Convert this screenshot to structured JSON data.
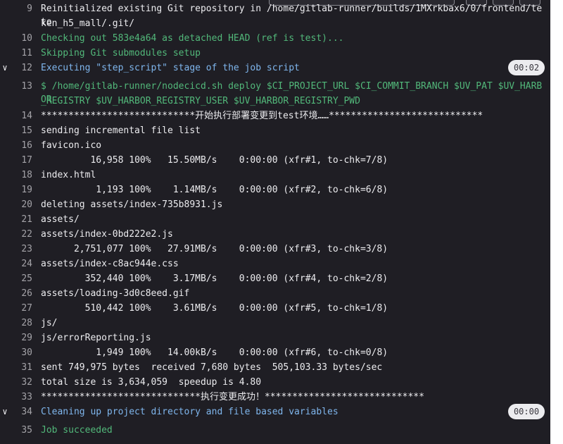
{
  "terminal": {
    "lines": [
      {
        "n": "9",
        "text": "Reinitialized existing Git repository in /home/gitlab-runner/builds/1MXrkbax6/0/frontend/teto",
        "color": "white"
      },
      {
        "n": "",
        "text": "ken_h5_mall/.git/",
        "color": "white"
      },
      {
        "n": "10",
        "text": "Checking out 583e4a64 as detached HEAD (ref is test)...",
        "color": "green"
      },
      {
        "n": "11",
        "text": "Skipping Git submodules setup",
        "color": "green"
      },
      {
        "n": "12",
        "text": "Executing \"step_script\" stage of the job script",
        "color": "blue",
        "collapsible": true,
        "duration": "00:02"
      },
      {
        "n": "13",
        "text": "$ /home/gitlab-runner/nodecicd.sh deploy $CI_PROJECT_URL $CI_COMMIT_BRANCH $UV_PAT $UV_HARBOR",
        "color": "green"
      },
      {
        "n": "",
        "text": "_REGISTRY $UV_HARBOR_REGISTRY_USER $UV_HARBOR_REGISTRY_PWD",
        "color": "green"
      },
      {
        "n": "14",
        "text": "****************************开始执行部署变更到test环境……****************************",
        "color": "white"
      },
      {
        "n": "15",
        "text": "sending incremental file list",
        "color": "white"
      },
      {
        "n": "16",
        "text": "favicon.ico",
        "color": "white"
      },
      {
        "n": "17",
        "text": "         16,958 100%   15.50MB/s    0:00:00 (xfr#1, to-chk=7/8)",
        "color": "white"
      },
      {
        "n": "18",
        "text": "index.html",
        "color": "white"
      },
      {
        "n": "19",
        "text": "          1,193 100%    1.14MB/s    0:00:00 (xfr#2, to-chk=6/8)",
        "color": "white"
      },
      {
        "n": "20",
        "text": "deleting assets/index-735b8931.js",
        "color": "white"
      },
      {
        "n": "21",
        "text": "assets/",
        "color": "white"
      },
      {
        "n": "22",
        "text": "assets/index-0bd222e2.js",
        "color": "white"
      },
      {
        "n": "23",
        "text": "      2,751,077 100%   27.91MB/s    0:00:00 (xfr#3, to-chk=3/8)",
        "color": "white"
      },
      {
        "n": "24",
        "text": "assets/index-c8ac944e.css",
        "color": "white"
      },
      {
        "n": "25",
        "text": "        352,440 100%    3.17MB/s    0:00:00 (xfr#4, to-chk=2/8)",
        "color": "white"
      },
      {
        "n": "26",
        "text": "assets/loading-3d0c8eed.gif",
        "color": "white"
      },
      {
        "n": "27",
        "text": "        510,442 100%    3.61MB/s    0:00:00 (xfr#5, to-chk=1/8)",
        "color": "white"
      },
      {
        "n": "28",
        "text": "js/",
        "color": "white"
      },
      {
        "n": "29",
        "text": "js/errorReporting.js",
        "color": "white"
      },
      {
        "n": "30",
        "text": "          1,949 100%   14.00kB/s    0:00:00 (xfr#6, to-chk=0/8)",
        "color": "white"
      },
      {
        "n": "31",
        "text": "sent 749,975 bytes  received 7,680 bytes  505,103.33 bytes/sec",
        "color": "white"
      },
      {
        "n": "32",
        "text": "total size is 3,634,059  speedup is 4.80",
        "color": "white"
      },
      {
        "n": "33",
        "text": "*****************************执行变更成功！*****************************",
        "color": "white"
      },
      {
        "n": "34",
        "text": "Cleaning up project directory and file based variables",
        "color": "blue",
        "collapsible": true,
        "duration": "00:00"
      },
      {
        "n": "35",
        "text": "Job succeeded",
        "color": "green"
      }
    ]
  },
  "icons": {
    "collapse": "chevron-down-icon"
  }
}
